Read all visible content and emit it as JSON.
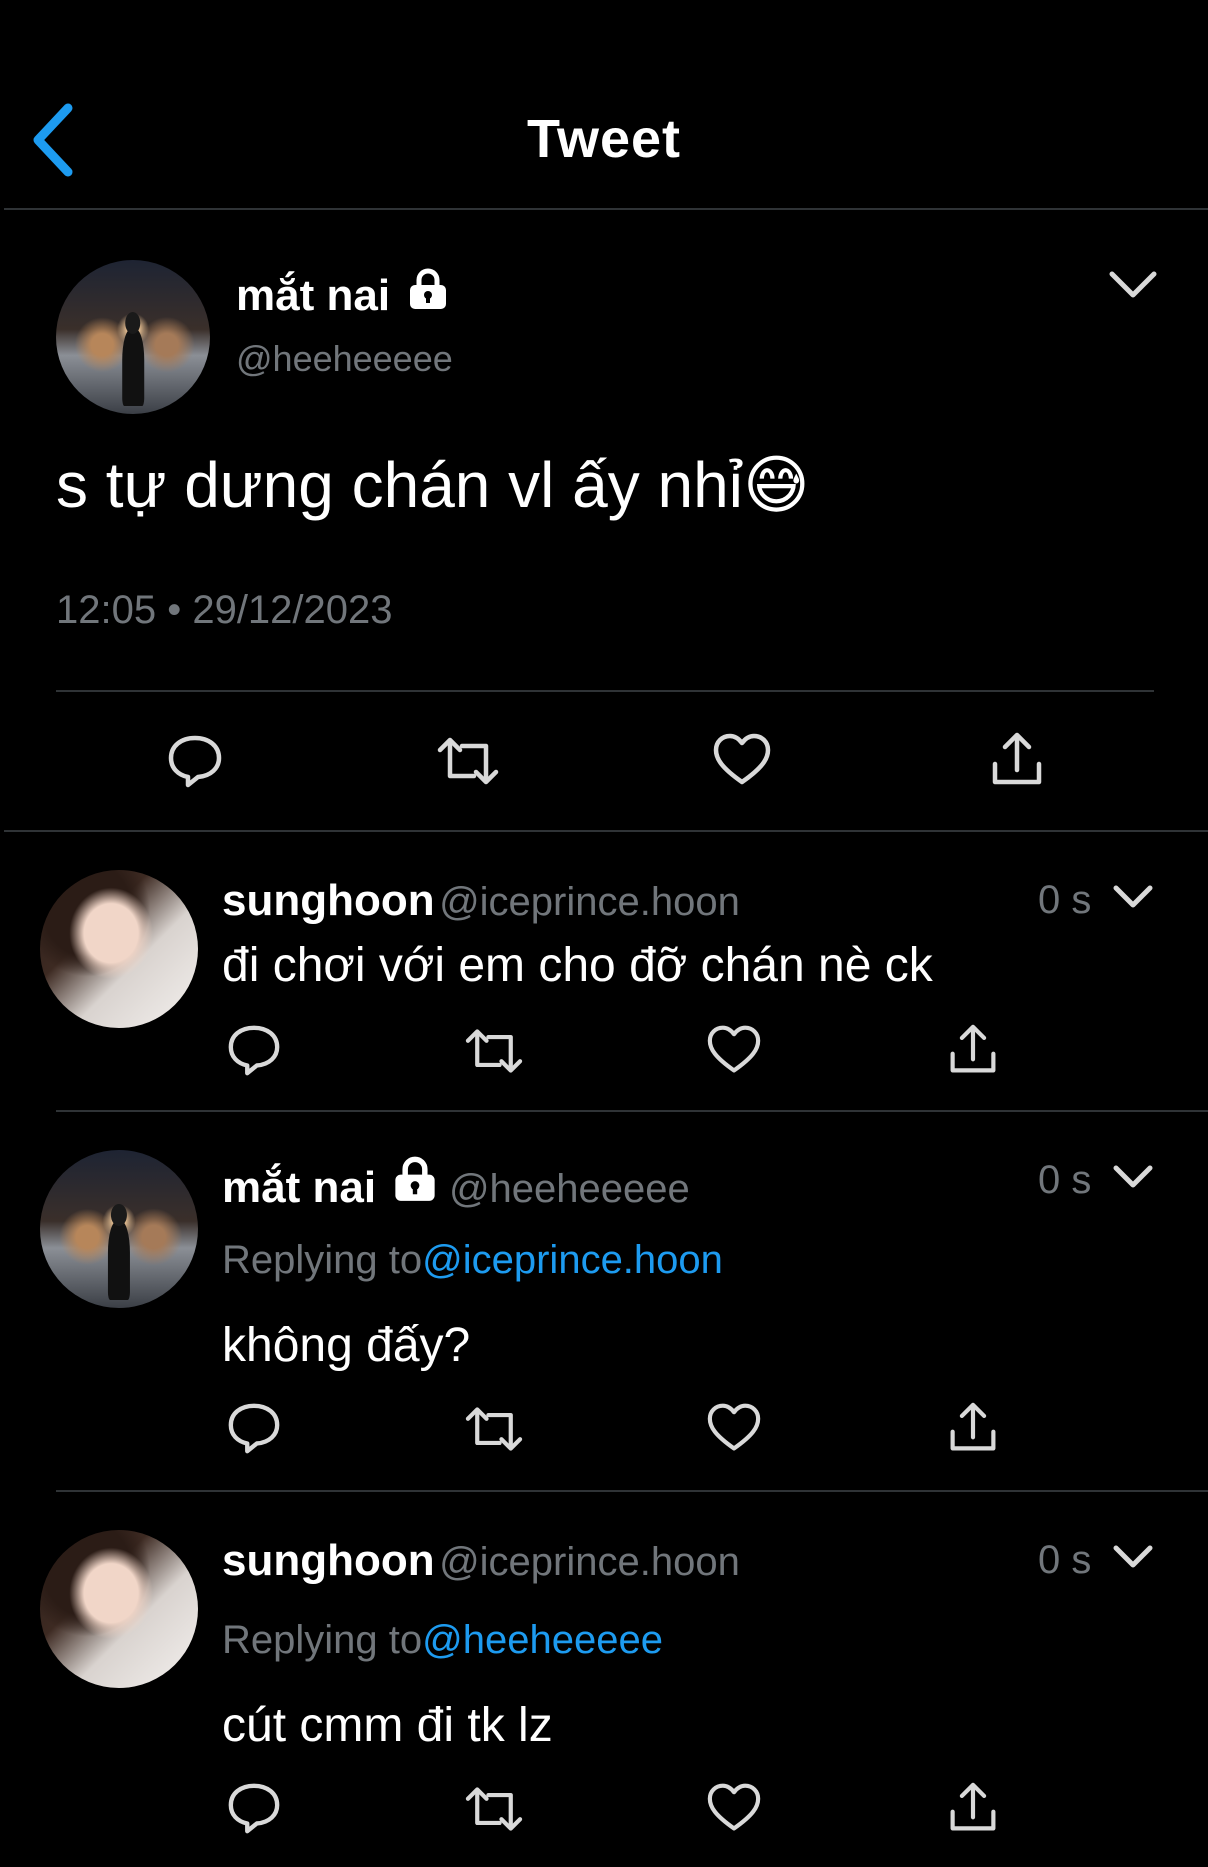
{
  "header": {
    "title": "Tweet"
  },
  "main_tweet": {
    "name": "mắt nai",
    "handle": "@heeheeeee",
    "text": "s tự dưng chán vl ấy nhỉ😅",
    "timestamp": "12:05 • 29/12/2023"
  },
  "replies": [
    {
      "name": "sunghoon",
      "handle": "@iceprince.hoon",
      "time": "0 s",
      "text": "đi chơi với em cho đỡ chán nè ck"
    },
    {
      "name": "mắt nai",
      "handle": "@heeheeeee",
      "time": "0 s",
      "replying_label": "Replying to",
      "replying_to": "@iceprince.hoon",
      "text": "không đấy?"
    },
    {
      "name": "sunghoon",
      "handle": "@iceprince.hoon",
      "time": "0 s",
      "replying_label": "Replying to",
      "replying_to": "@heeheeeee",
      "text": "cút cmm đi tk lz"
    }
  ],
  "colors": {
    "accent": "#1d9bf0",
    "muted": "#71767b",
    "divider": "#2f3336",
    "background": "#000000"
  },
  "icons": [
    "back-arrow-icon",
    "lock-icon",
    "chevron-down-icon",
    "reply-icon",
    "retweet-icon",
    "like-icon",
    "share-icon"
  ]
}
